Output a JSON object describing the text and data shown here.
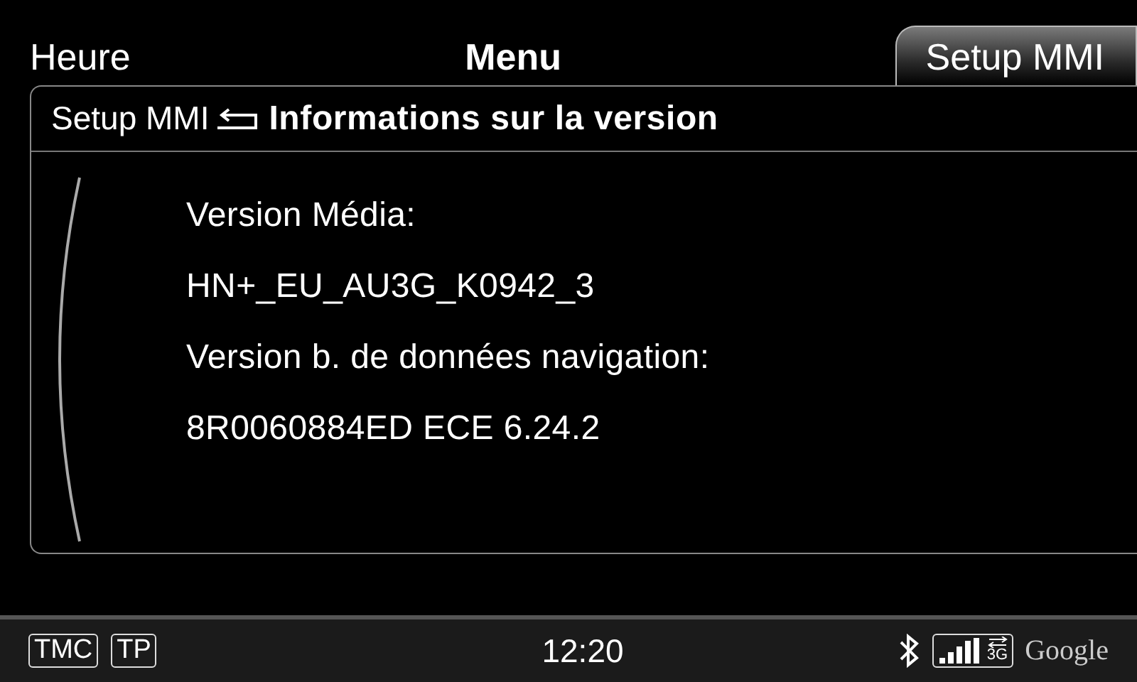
{
  "tabs": [
    {
      "label": "Heure",
      "kind": "side",
      "selected": false
    },
    {
      "label": "Menu",
      "kind": "center",
      "selected": false
    },
    {
      "label": "Setup MMI",
      "kind": "side",
      "selected": true
    }
  ],
  "breadcrumb": {
    "parent": "Setup MMI",
    "title": "Informations sur la version"
  },
  "lines": [
    "Version Média:",
    "HN+_EU_AU3G_K0942_3",
    "Version b. de données navigation:",
    "8R0060884ED ECE 6.24.2"
  ],
  "status_bar": {
    "indicators": [
      "TMC",
      "TP"
    ],
    "time": "12:20",
    "network": "3G",
    "provider": "Google"
  }
}
